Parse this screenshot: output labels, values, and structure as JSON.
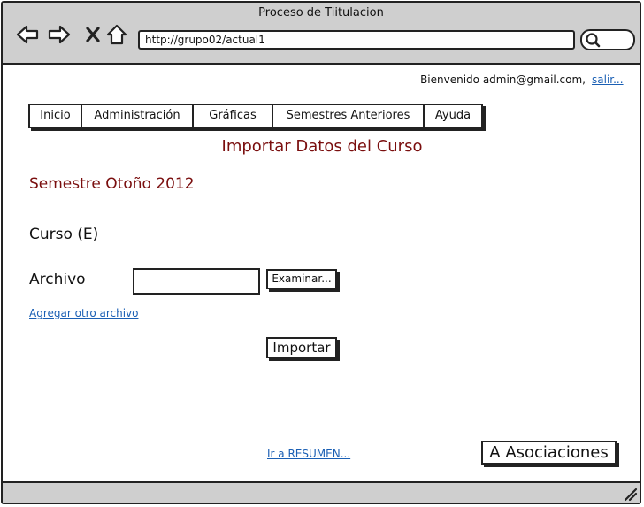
{
  "window": {
    "title": "Proceso de Tiitulacion",
    "url": "http://grupo02/actual1"
  },
  "nav_icons": [
    "back-arrow-icon",
    "forward-arrow-icon",
    "close-x-icon",
    "home-icon",
    "search-icon"
  ],
  "header": {
    "welcome_text": "Bienvenido admin@gmail.com,",
    "logout_label": "salir..."
  },
  "menu": {
    "items": [
      {
        "label": "Inicio"
      },
      {
        "label": "Administración"
      },
      {
        "label": "Gráficas"
      },
      {
        "label": "Semestres Anteriores"
      },
      {
        "label": "Ayuda"
      }
    ]
  },
  "main": {
    "page_title": "Importar Datos del Curso",
    "semester": "Semestre Otoño 2012",
    "course": "Curso (E)",
    "file_label": "Archivo",
    "file_value": "",
    "browse_label": "Examinar...",
    "add_file_link": "Agregar otro archivo",
    "import_label": "Importar",
    "summary_link": "Ir a RESUMEN...",
    "associations_label": "A Asociaciones"
  },
  "colors": {
    "chrome": "#cfcfcf",
    "heading": "#7a0e0e",
    "link": "#1a5fb4"
  }
}
